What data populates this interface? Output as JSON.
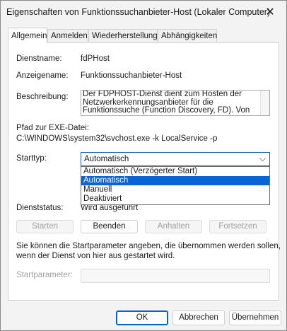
{
  "window": {
    "title": "Eigenschaften von Funktionssuchanbieter-Host (Lokaler Computer)",
    "close_glyph": "✕"
  },
  "tabs": [
    "Allgemein",
    "Anmelden",
    "Wiederherstellung",
    "Abhängigkeiten"
  ],
  "general": {
    "service_name_label": "Dienstname:",
    "service_name_value": "fdPHost",
    "display_name_label": "Anzeigename:",
    "display_name_value": "Funktionssuchanbieter-Host",
    "description_label": "Beschreibung:",
    "description_lines": [
      "Der FDPHOST-Dienst dient zum Hosten der",
      "Netzwerkerkennungsanbieter für die",
      "Funktionssuche (Function Discovery, FD). Von"
    ],
    "exe_path_label": "Pfad zur EXE-Datei:",
    "exe_path_value": "C:\\WINDOWS\\system32\\svchost.exe -k LocalService -p",
    "start_type_label": "Starttyp:",
    "start_type_value": "Automatisch",
    "start_type_options": [
      "Automatisch (Verzögerter Start)",
      "Automatisch",
      "Manuell",
      "Deaktiviert"
    ],
    "start_type_selected_index": 1,
    "service_status_label": "Dienststatus:",
    "service_status_value": "Wird ausgeführt",
    "buttons": {
      "start": "Starten",
      "stop": "Beenden",
      "pause": "Anhalten",
      "resume": "Fortsetzen"
    },
    "info_text_lines": [
      "Sie können die Startparameter angeben, die übernommen werden sollen,",
      "wenn der Dienst von hier aus gestartet wird."
    ],
    "start_params_label": "Startparameter:",
    "start_params_value": ""
  },
  "dialog_buttons": {
    "ok": "OK",
    "cancel": "Abbrechen",
    "apply": "Übernehmen"
  }
}
